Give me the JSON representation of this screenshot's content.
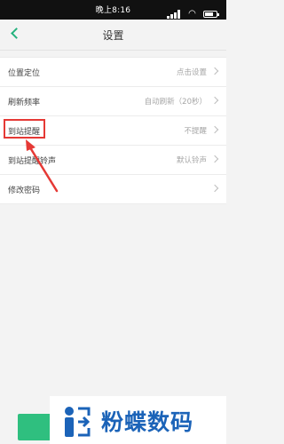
{
  "status_bar": {
    "time": "晚上8:16",
    "icons": [
      "signal-icon",
      "wifi-icon",
      "battery-icon"
    ]
  },
  "nav": {
    "title": "设置",
    "back_icon": "chevron-left-icon"
  },
  "settings": [
    {
      "label": "位置定位",
      "value": "点击设置"
    },
    {
      "label": "刷新频率",
      "value": "自动刷新（20秒）"
    },
    {
      "label": "到站提醒",
      "value": "不提醒"
    },
    {
      "label": "到站提醒铃声",
      "value": "默认铃声"
    },
    {
      "label": "修改密码",
      "value": ""
    }
  ],
  "annotation": {
    "highlighted_item": "到站提醒",
    "color": "#e53935"
  },
  "watermark": {
    "brand": "粉蝶数码"
  },
  "colors": {
    "accent": "#24b27e",
    "button": "#2fbf7f",
    "brand": "#1b63b8",
    "background": "#f3f3f3"
  }
}
